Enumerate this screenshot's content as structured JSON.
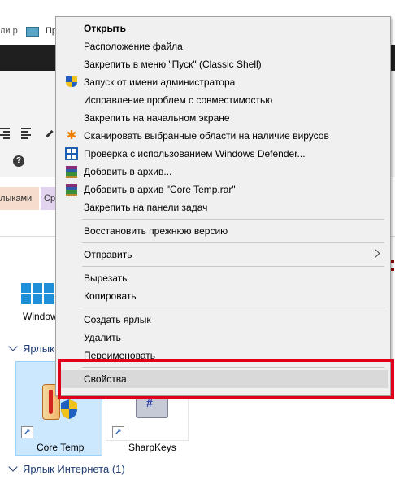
{
  "background": {
    "topbar_text_left": "ли р",
    "topbar_text_right": "Пр",
    "tab_a_label": "лыками",
    "tab_b_label": "Ср",
    "help_icon_glyph": "?",
    "window_item_label": "Window",
    "group_shortcuts_label": "Ярлык",
    "tile1_label": "Core Temp",
    "tile2_label": "SharpKeys",
    "group_internet_label": "Ярлык Интернета (1)",
    "sharpkeys_glyph": "#",
    "shortcut_arrow_glyph": "↗"
  },
  "menu": {
    "items": [
      {
        "label": "Открыть",
        "icon": "none"
      },
      {
        "label": "Расположение файла",
        "icon": "none"
      },
      {
        "label": "Закрепить в меню \"Пуск\" (Classic Shell)",
        "icon": "none"
      },
      {
        "label": "Запуск от имени администратора",
        "icon": "uac-shield-icon"
      },
      {
        "label": "Исправление проблем с совместимостью",
        "icon": "none"
      },
      {
        "label": "Закрепить на начальном экране",
        "icon": "none"
      },
      {
        "label": "Сканировать выбранные области на наличие вирусов",
        "icon": "avast-icon"
      },
      {
        "label": "Проверка с использованием Windows Defender...",
        "icon": "windows-defender-icon"
      },
      {
        "label": "Добавить в архив...",
        "icon": "winrar-icon"
      },
      {
        "label": "Добавить в архив \"Core Temp.rar\"",
        "icon": "winrar-icon"
      },
      {
        "label": "Закрепить на панели задач",
        "icon": "none"
      },
      {
        "label": "Восстановить прежнюю версию",
        "icon": "none"
      },
      {
        "label": "Отправить",
        "icon": "none"
      },
      {
        "label": "Вырезать",
        "icon": "none"
      },
      {
        "label": "Копировать",
        "icon": "none"
      },
      {
        "label": "Создать ярлык",
        "icon": "none"
      },
      {
        "label": "Удалить",
        "icon": "none"
      },
      {
        "label": "Переименовать",
        "icon": "none"
      },
      {
        "label": "Свойства",
        "icon": "none"
      }
    ],
    "avast_glyph": "✱"
  },
  "colors": {
    "highlight_border": "#e0001b",
    "menu_background": "#f0f0f0",
    "hover_background": "#d9d9d9",
    "selected_tile": "#cce8ff"
  }
}
